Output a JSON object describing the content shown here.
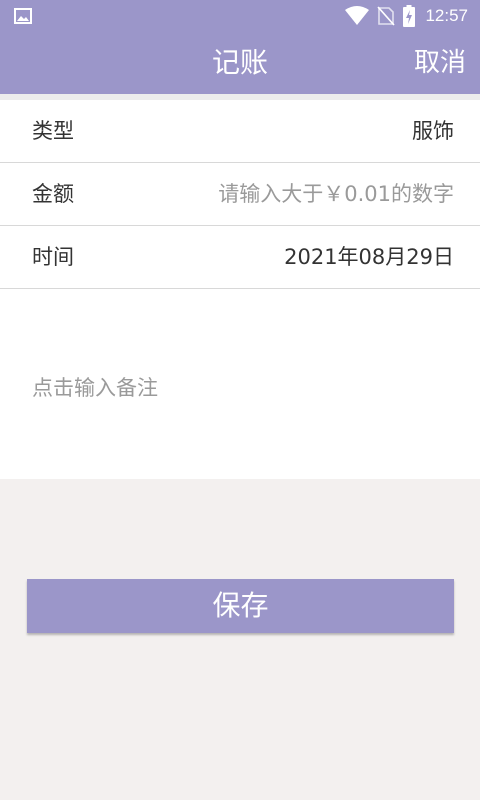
{
  "colors": {
    "primary": "#9b96c9",
    "background": "#f3f0ef",
    "text": "#333333",
    "placeholder": "#9a9a9a"
  },
  "status_bar": {
    "left_icon": "image-icon",
    "icons": [
      "wifi-icon",
      "no-sim-icon",
      "battery-charging-icon"
    ],
    "time": "12:57"
  },
  "toolbar": {
    "title": "记账",
    "cancel_label": "取消"
  },
  "form": {
    "type": {
      "label": "类型",
      "value": "服饰"
    },
    "amount": {
      "label": "金额",
      "placeholder": "请输入大于￥0.01的数字"
    },
    "time": {
      "label": "时间",
      "value": "2021年08月29日"
    },
    "note_placeholder": "点击输入备注"
  },
  "save_label": "保存"
}
